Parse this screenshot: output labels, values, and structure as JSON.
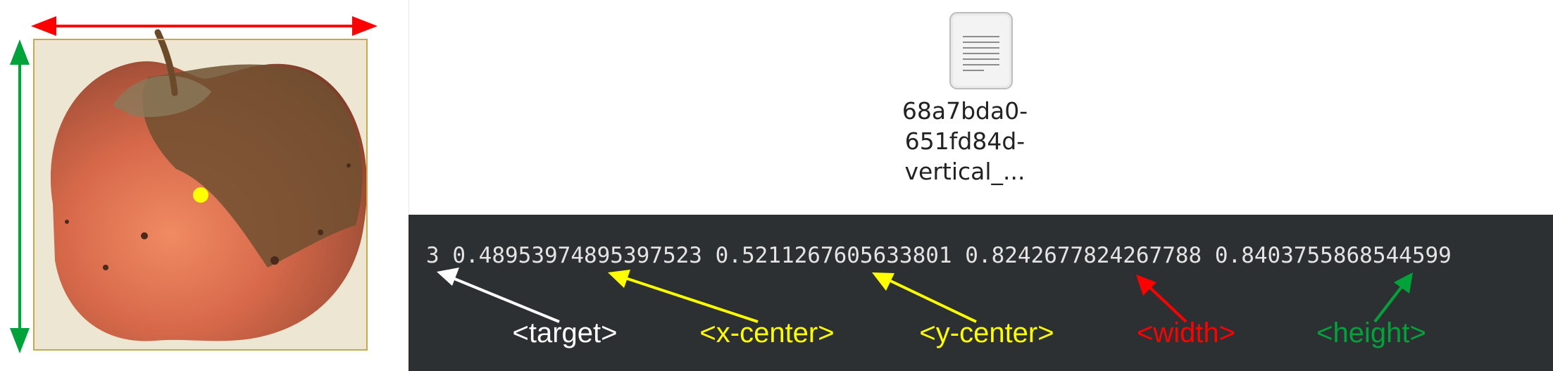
{
  "file": {
    "name_lines": [
      "68a7bda0-",
      "651fd84d-",
      "vertical_..."
    ],
    "icon": "text-file-icon"
  },
  "label": {
    "line": "3 0.48953974895397523 0.5211267605633801 0.8242677824267788 0.8403755868544599",
    "fields": [
      {
        "key": "target",
        "value": "3",
        "caption": "<target>",
        "color": "#ffffff"
      },
      {
        "key": "x_center",
        "value": "0.48953974895397523",
        "caption": "<x-center>",
        "color": "#ffff00"
      },
      {
        "key": "y_center",
        "value": "0.5211267605633801",
        "caption": "<y-center>",
        "color": "#ffff00"
      },
      {
        "key": "width",
        "value": "0.8242677824267788",
        "caption": "<width>",
        "color": "#ff0000"
      },
      {
        "key": "height",
        "value": "0.8403755868544599",
        "caption": "<height>",
        "color": "#00a23a"
      }
    ]
  },
  "colors": {
    "terminal_bg": "#2d3033",
    "width_arrow": "#ff0000",
    "height_arrow": "#00a23a",
    "center_dot": "#ffff00",
    "bbox_outline": "#c8a84b"
  }
}
